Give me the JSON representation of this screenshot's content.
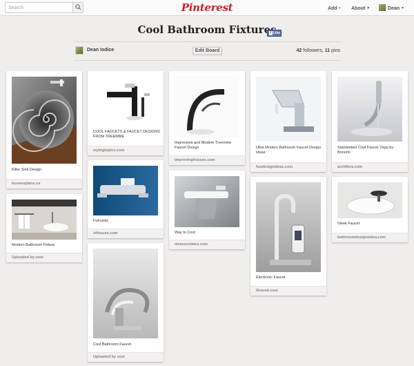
{
  "topbar": {
    "search_placeholder": "Search",
    "logo": "Pinterest",
    "nav": {
      "add": "Add",
      "about": "About",
      "user": "Dean"
    }
  },
  "board": {
    "title": "Cool Bathroom Fixtures",
    "like_label": "Like",
    "owner": "Dean Iodice",
    "edit_label": "Edit Board",
    "followers_count": "42",
    "followers_label": "followers,",
    "pins_count": "11",
    "pins_label": "pins"
  },
  "pins": [
    {
      "caption": "Killer Sink Design",
      "source": "housesplans.us"
    },
    {
      "caption": "Modern Bathroom Fixture",
      "source": "Uploaded by user"
    },
    {
      "caption": "COOL FAUCETS & FAUCET DESIGNS FROM TREEMME",
      "source": "mybigtopics.com"
    },
    {
      "caption": "Futruistic",
      "source": "vithouse.com"
    },
    {
      "caption": "Cool Bathroom Faucet",
      "source": "Uploaded by user"
    },
    {
      "caption": "Impressive and Modern Treemme Faucet Design",
      "source": "improvinghouses.com"
    },
    {
      "caption": "Way to Cool",
      "source": "mrassociates.com"
    },
    {
      "caption": "Ultra Modern Bathroom Faucet Design Ideas",
      "source": "fundesignideas.com"
    },
    {
      "caption": "Electronic Faucet",
      "source": "ilevunk.com"
    },
    {
      "caption": "Stainlesteel Cool Faucet Virgo by Bonomi",
      "source": "archifera.com"
    },
    {
      "caption": "Sleek Faucet",
      "source": "bathroomdesignsidea.com"
    }
  ]
}
